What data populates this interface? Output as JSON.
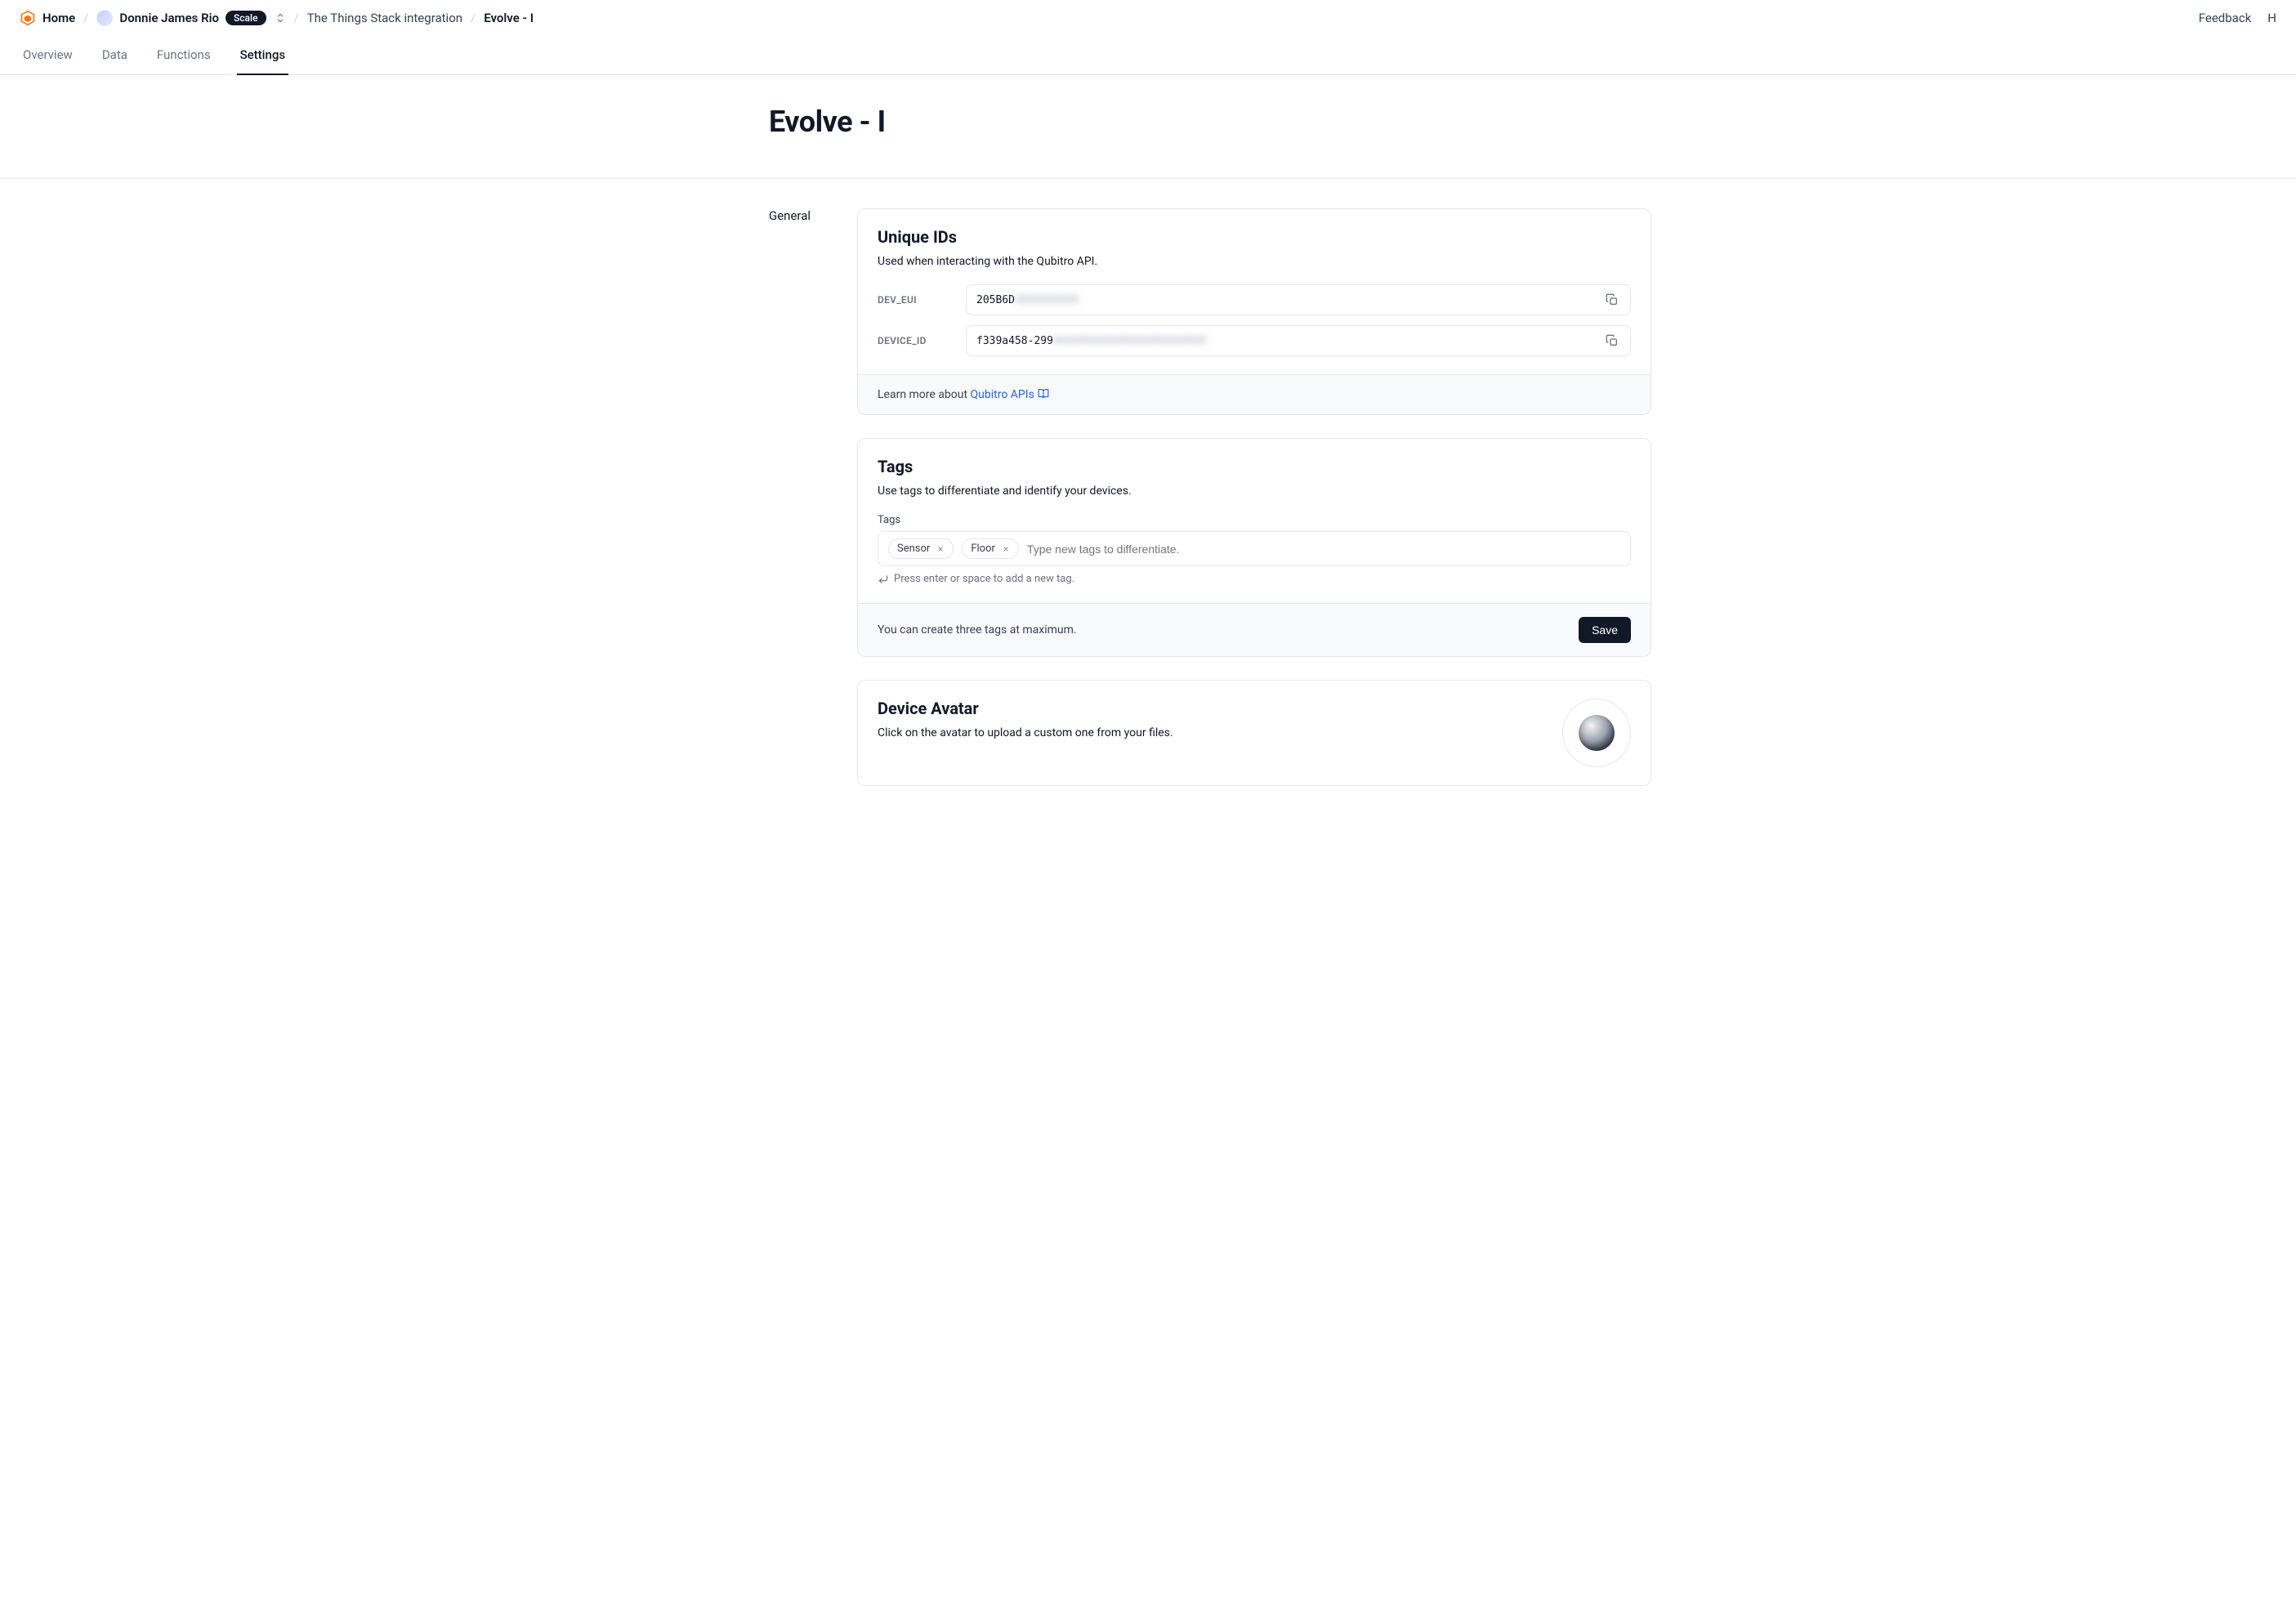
{
  "breadcrumb": {
    "home": "Home",
    "org_name": "Donnie James  Rio",
    "org_pill": "Scale",
    "integration": "The Things Stack integration",
    "current": "Evolve - I"
  },
  "header_links": {
    "feedback": "Feedback",
    "help_truncated": "H"
  },
  "tabs": [
    {
      "id": "overview",
      "label": "Overview",
      "active": false
    },
    {
      "id": "data",
      "label": "Data",
      "active": false
    },
    {
      "id": "functions",
      "label": "Functions",
      "active": false
    },
    {
      "id": "settings",
      "label": "Settings",
      "active": true
    }
  ],
  "page_title": "Evolve - I",
  "sidebar": {
    "items": [
      {
        "id": "general",
        "label": "General"
      }
    ]
  },
  "unique_ids": {
    "title": "Unique IDs",
    "desc": "Used when interacting with the Qubitro API.",
    "fields": [
      {
        "label": "DEV_EUI",
        "value_visible": "205B6D",
        "value_obscured": "XXXXXXXXXX"
      },
      {
        "label": "DEVICE_ID",
        "value_visible": "f339a458-299",
        "value_obscured": "XXXXXXXXXXXXXXXXXXXXXXXX"
      }
    ],
    "footer_prefix": "Learn more about ",
    "footer_link": "Qubitro APIs"
  },
  "tags": {
    "title": "Tags",
    "desc": "Use tags to differentiate and identify your devices.",
    "field_label": "Tags",
    "chips": [
      "Sensor",
      "Floor"
    ],
    "placeholder": "Type new tags to differentiate.",
    "hint": "Press enter or space to add a new tag.",
    "footer_text": "You can create three tags at maximum.",
    "save_label": "Save"
  },
  "avatar": {
    "title": "Device Avatar",
    "desc": "Click on the avatar to upload a custom one from your files."
  }
}
